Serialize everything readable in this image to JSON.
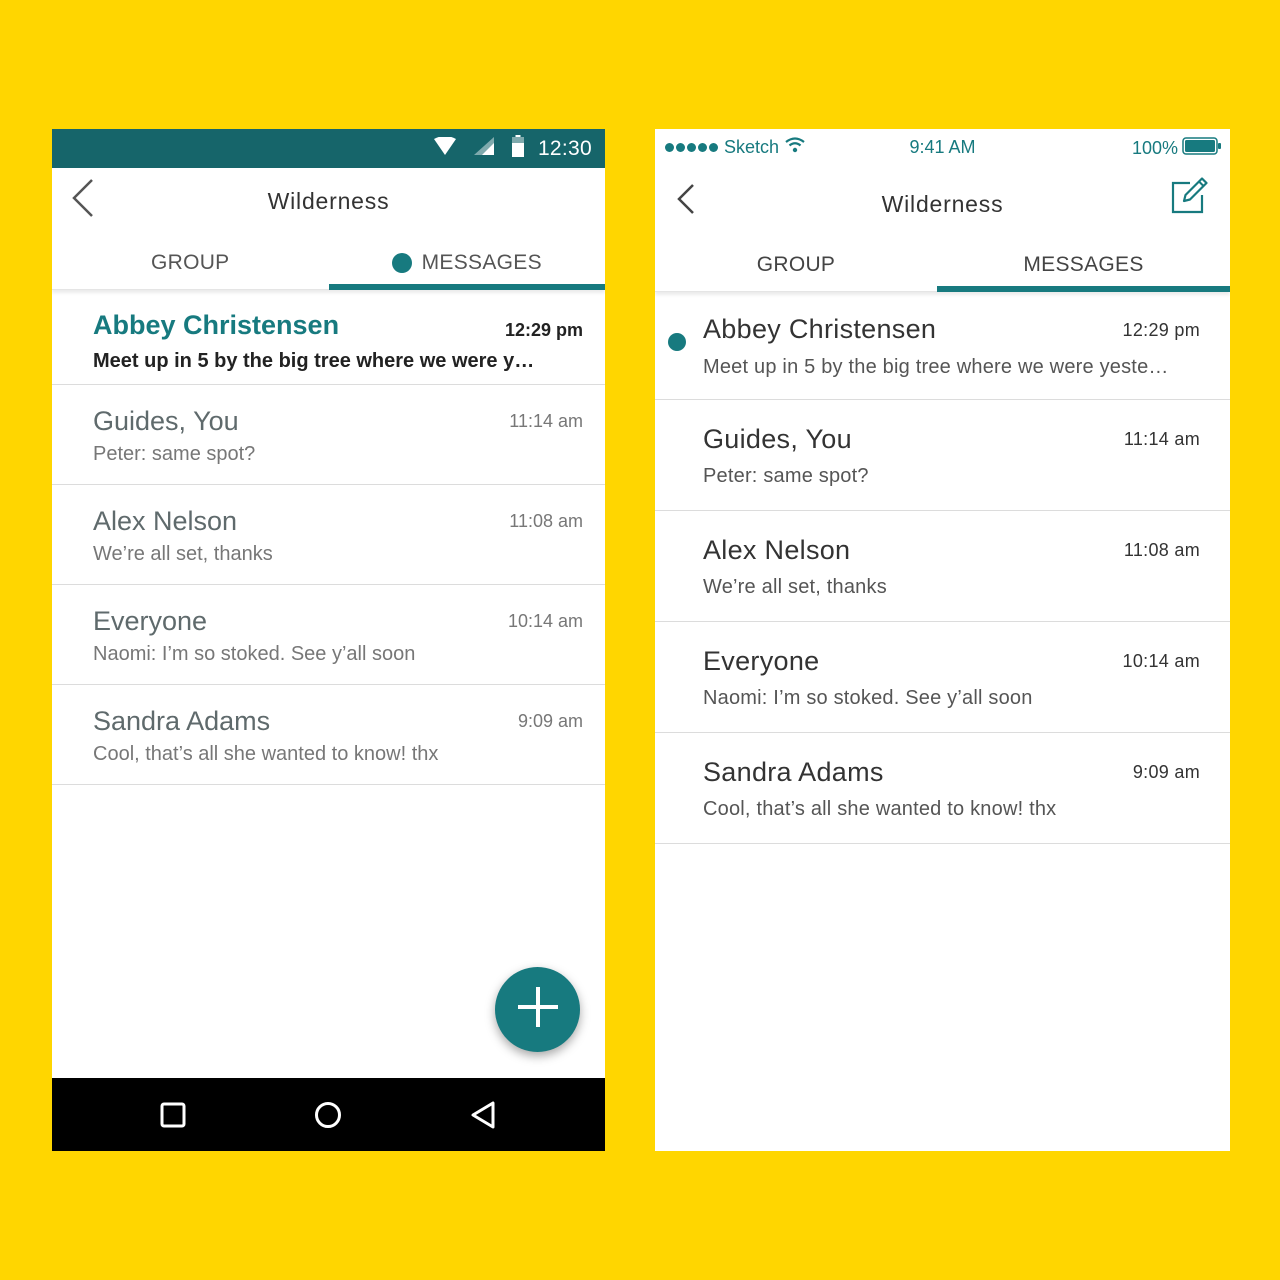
{
  "android": {
    "status_time": "12:30",
    "title": "Wilderness",
    "tabs": [
      {
        "label": "GROUP"
      },
      {
        "label": "MESSAGES"
      }
    ],
    "active_tab": "MESSAGES",
    "conversations": [
      {
        "name": "Abbey Christensen",
        "time": "12:29 pm",
        "message": "Meet up in 5 by the big tree where we were y…",
        "unread": true
      },
      {
        "name": "Guides, You",
        "time": "11:14 am",
        "message": "Peter: same spot?",
        "unread": false
      },
      {
        "name": "Alex Nelson",
        "time": "11:08 am",
        "message": "We’re all set, thanks",
        "unread": false
      },
      {
        "name": "Everyone",
        "time": "10:14 am",
        "message": "Naomi: I’m so stoked. See y’all soon",
        "unread": false
      },
      {
        "name": "Sandra Adams",
        "time": "9:09 am",
        "message": "Cool, that’s all she wanted to know! thx",
        "unread": false
      }
    ],
    "icons": [
      "wifi-icon",
      "signal-icon",
      "battery-icon",
      "back-arrow-icon",
      "plus-icon",
      "recents-square-icon",
      "home-circle-icon",
      "back-triangle-icon"
    ]
  },
  "ios": {
    "carrier": "Sketch",
    "status_time": "9:41 AM",
    "battery": "100%",
    "title": "Wilderness",
    "tabs": [
      {
        "label": "GROUP"
      },
      {
        "label": "MESSAGES"
      }
    ],
    "active_tab": "MESSAGES",
    "conversations": [
      {
        "name": "Abbey Christensen",
        "time": "12:29 pm",
        "message": "Meet up in 5 by the big tree where we were yeste…",
        "unread": true
      },
      {
        "name": "Guides, You",
        "time": "11:14 am",
        "message": "Peter: same spot?",
        "unread": false
      },
      {
        "name": "Alex Nelson",
        "time": "11:08 am",
        "message": "We’re all set, thanks",
        "unread": false
      },
      {
        "name": "Everyone",
        "time": "10:14 am",
        "message": "Naomi: I’m so stoked. See y’all soon",
        "unread": false
      },
      {
        "name": "Sandra Adams",
        "time": "9:09 am",
        "message": "Cool, that’s all she wanted to know! thx",
        "unread": false
      }
    ],
    "icons": [
      "signal-dots-icon",
      "wifi-icon",
      "battery-icon",
      "back-chevron-icon",
      "compose-icon"
    ]
  },
  "colors": {
    "background": "#FFD600",
    "accent": "#177A7F",
    "android_status_bar": "#16656A",
    "android_nav_bar": "#000000"
  }
}
